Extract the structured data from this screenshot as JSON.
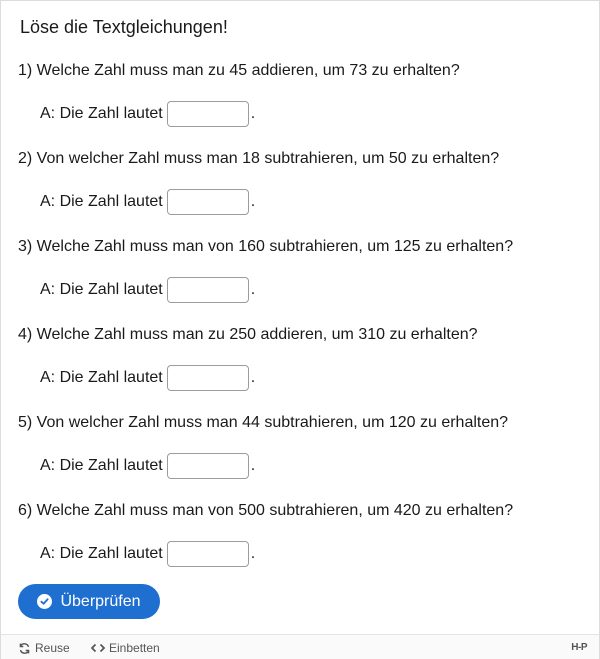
{
  "title": "Löse die Textgleichungen!",
  "questions": [
    {
      "text": "1) Welche Zahl muss man zu 45 addieren, um 73 zu erhalten?",
      "answer_prefix": "A: Die Zahl lautet",
      "answer_value": "",
      "suffix": "."
    },
    {
      "text": "2) Von welcher Zahl muss man 18 subtrahieren, um 50 zu erhalten?",
      "answer_prefix": "A: Die Zahl lautet",
      "answer_value": "",
      "suffix": "."
    },
    {
      "text": "3) Welche Zahl muss man von 160 subtrahieren, um 125 zu erhalten?",
      "answer_prefix": "A: Die Zahl lautet",
      "answer_value": "",
      "suffix": "."
    },
    {
      "text": "4) Welche Zahl muss man zu 250 addieren, um 310 zu erhalten?",
      "answer_prefix": "A: Die Zahl lautet",
      "answer_value": "",
      "suffix": "."
    },
    {
      "text": "5) Von welcher Zahl muss man 44 subtrahieren, um 120 zu erhalten?",
      "answer_prefix": "A: Die Zahl lautet",
      "answer_value": "",
      "suffix": "."
    },
    {
      "text": "6) Welche Zahl muss man von 500 subtrahieren, um 420 zu erhalten?",
      "answer_prefix": "A: Die Zahl lautet",
      "answer_value": "",
      "suffix": "."
    }
  ],
  "check_button": {
    "label": "Überprüfen",
    "icon": "check-circle-icon",
    "color": "#1f6fd1"
  },
  "footer": {
    "reuse_label": "Reuse",
    "reuse_icon": "reuse-icon",
    "embed_label": "Einbetten",
    "embed_icon": "embed-icon",
    "brand": "H-P"
  }
}
